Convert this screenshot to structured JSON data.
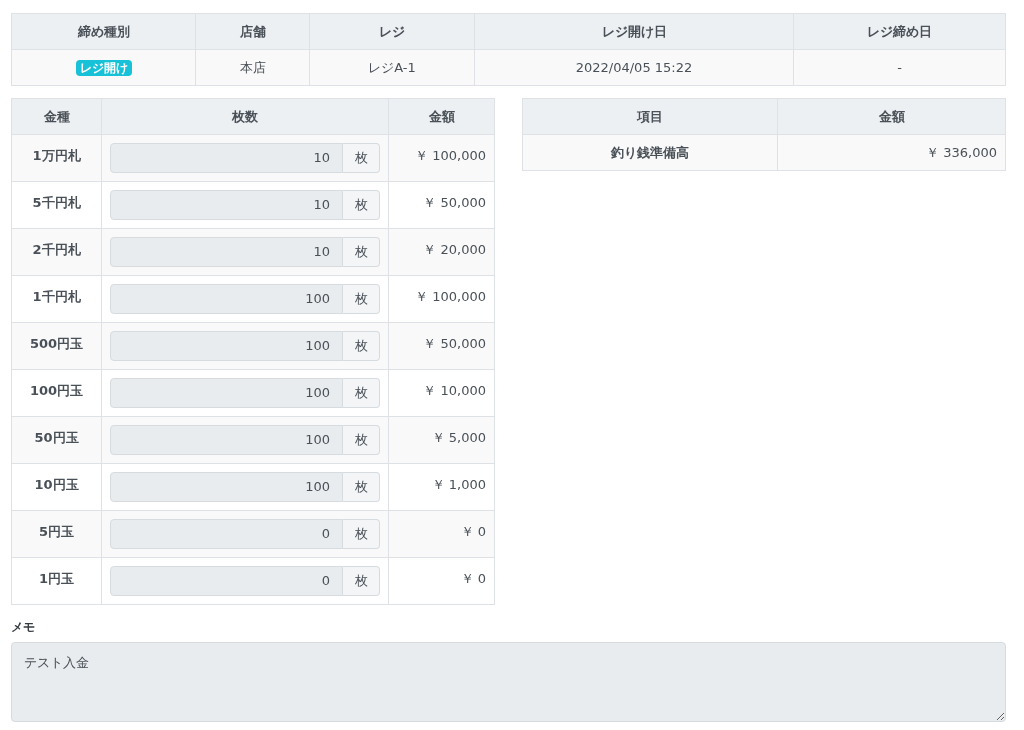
{
  "summary_table": {
    "columns": [
      "締め種別",
      "店舗",
      "レジ",
      "レジ開け日",
      "レジ締め日"
    ],
    "row": {
      "type_badge": "レジ開け",
      "store": "本店",
      "register": "レジA-1",
      "opened": "2022/04/05 15:22",
      "closed": "-"
    }
  },
  "denomination_table": {
    "columns": [
      "金種",
      "枚数",
      "金額"
    ],
    "rows": [
      {
        "denomination": "1万円札",
        "count": "10",
        "unit": "枚",
        "amount": "￥ 100,000"
      },
      {
        "denomination": "5千円札",
        "count": "10",
        "unit": "枚",
        "amount": "￥ 50,000"
      },
      {
        "denomination": "2千円札",
        "count": "10",
        "unit": "枚",
        "amount": "￥ 20,000"
      },
      {
        "denomination": "1千円札",
        "count": "100",
        "unit": "枚",
        "amount": "￥ 100,000"
      },
      {
        "denomination": "500円玉",
        "count": "100",
        "unit": "枚",
        "amount": "￥ 50,000"
      },
      {
        "denomination": "100円玉",
        "count": "100",
        "unit": "枚",
        "amount": "￥ 10,000"
      },
      {
        "denomination": "50円玉",
        "count": "100",
        "unit": "枚",
        "amount": "￥ 5,000"
      },
      {
        "denomination": "10円玉",
        "count": "100",
        "unit": "枚",
        "amount": "￥ 1,000"
      },
      {
        "denomination": "5円玉",
        "count": "0",
        "unit": "枚",
        "amount": "￥ 0"
      },
      {
        "denomination": "1円玉",
        "count": "0",
        "unit": "枚",
        "amount": "￥ 0"
      }
    ]
  },
  "total_table": {
    "columns": [
      "項目",
      "金額"
    ],
    "rows": [
      {
        "item": "釣り銭準備高",
        "amount": "￥ 336,000"
      }
    ]
  },
  "memo": {
    "label": "メモ",
    "value": "テスト入金"
  }
}
